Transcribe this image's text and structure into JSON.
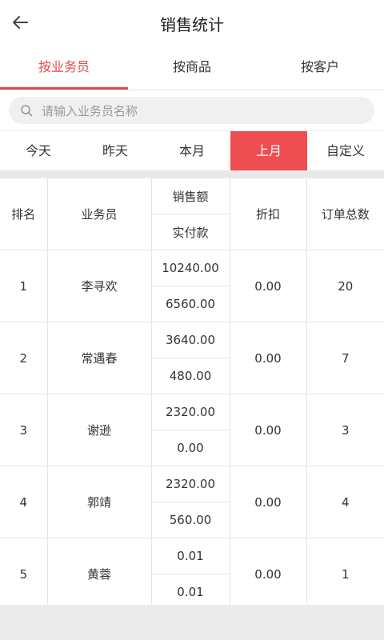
{
  "header": {
    "title": "销售统计"
  },
  "tabs": [
    {
      "label": "按业务员",
      "active": true
    },
    {
      "label": "按商品",
      "active": false
    },
    {
      "label": "按客户",
      "active": false
    }
  ],
  "search": {
    "placeholder": "请输入业务员名称"
  },
  "ranges": [
    {
      "label": "今天",
      "active": false
    },
    {
      "label": "昨天",
      "active": false
    },
    {
      "label": "本月",
      "active": false
    },
    {
      "label": "上月",
      "active": true
    },
    {
      "label": "自定义",
      "active": false
    }
  ],
  "table": {
    "headers": {
      "rank": "排名",
      "salesman": "业务员",
      "sales_amount": "销售额",
      "actual_paid": "实付款",
      "discount": "折扣",
      "order_count": "订单总数"
    },
    "rows": [
      {
        "rank": "1",
        "salesman": "李寻欢",
        "sales_amount": "10240.00",
        "actual_paid": "6560.00",
        "discount": "0.00",
        "order_count": "20"
      },
      {
        "rank": "2",
        "salesman": "常遇春",
        "sales_amount": "3640.00",
        "actual_paid": "480.00",
        "discount": "0.00",
        "order_count": "7"
      },
      {
        "rank": "3",
        "salesman": "谢逊",
        "sales_amount": "2320.00",
        "actual_paid": "0.00",
        "discount": "0.00",
        "order_count": "3"
      },
      {
        "rank": "4",
        "salesman": "郭靖",
        "sales_amount": "2320.00",
        "actual_paid": "560.00",
        "discount": "0.00",
        "order_count": "4"
      },
      {
        "rank": "5",
        "salesman": "黄蓉",
        "sales_amount": "0.01",
        "actual_paid": "0.01",
        "discount": "0.00",
        "order_count": "1"
      }
    ]
  },
  "colors": {
    "accent": "#e2494b",
    "active_range_bg": "#ee4e4f"
  },
  "icons": {
    "back": "arrow-left-icon",
    "search": "search-icon"
  }
}
